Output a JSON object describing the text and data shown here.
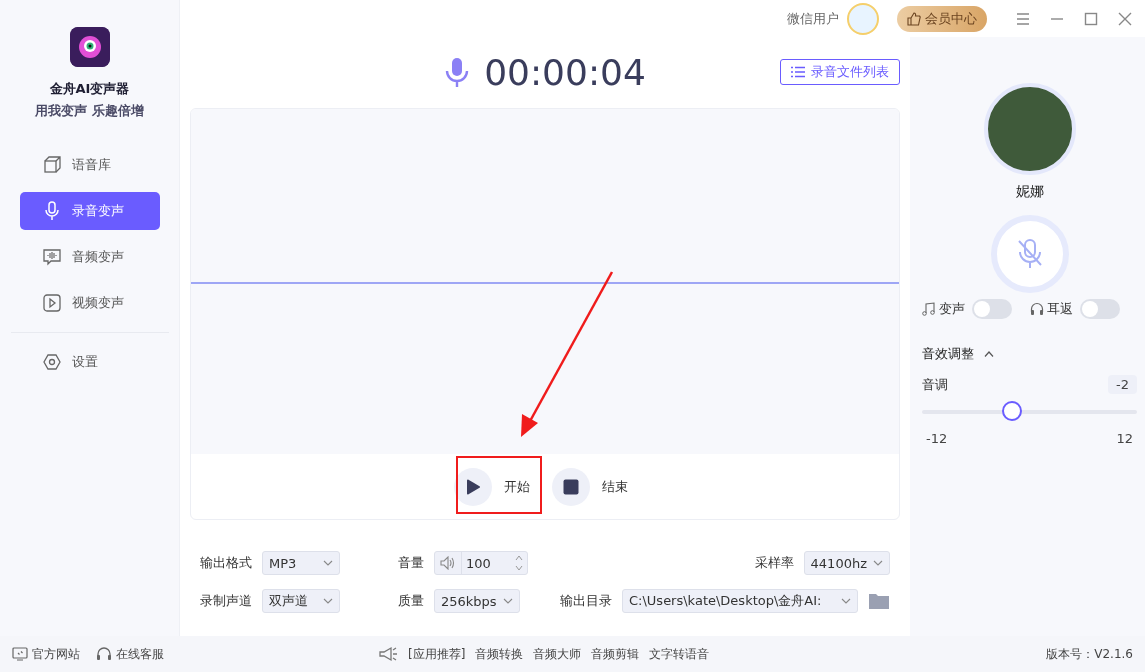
{
  "app": {
    "name": "金舟AI变声器",
    "slogan": "用我变声 乐趣倍增"
  },
  "sidebar": {
    "items": [
      {
        "label": "语音库",
        "kind": "library",
        "selected": false
      },
      {
        "label": "录音变声",
        "kind": "mic",
        "selected": true
      },
      {
        "label": "音频变声",
        "kind": "audio",
        "selected": false
      },
      {
        "label": "视频变声",
        "kind": "video",
        "selected": false
      }
    ],
    "bottom_items": [
      {
        "label": "设置",
        "kind": "settings",
        "selected": false
      }
    ]
  },
  "topbar": {
    "user": "微信用户",
    "vip_button": "会员中心"
  },
  "timer": "00:00:04",
  "record_list_button": "录音文件列表",
  "controls": [
    {
      "label": "开始",
      "kind": "play"
    },
    {
      "label": "结束",
      "kind": "stop"
    }
  ],
  "settings": [
    {
      "label": "输出格式",
      "value": "MP3",
      "kind": "select"
    },
    {
      "label": "音量",
      "value": "100",
      "kind": "volume"
    },
    {
      "label": "采样率",
      "value": "44100hz",
      "kind": "select"
    },
    {
      "label": "录制声道",
      "value": "双声道",
      "kind": "select"
    },
    {
      "label": "质量",
      "value": "256kbps",
      "kind": "select"
    },
    {
      "label": "输出目录",
      "value": "C:\\Users\\kate\\Desktop\\金舟AI:",
      "kind": "folder"
    }
  ],
  "voice": {
    "name": "妮娜"
  },
  "toggles": [
    {
      "label": "变声",
      "kind": "music",
      "on": false
    },
    {
      "label": "耳返",
      "kind": "headphones",
      "on": false
    }
  ],
  "effects": {
    "title": "音效调整",
    "expanded": true,
    "sliders": [
      {
        "label": "音调",
        "reading": "-2",
        "level": 0.417,
        "min": "-12",
        "max": "12"
      }
    ]
  },
  "footer": {
    "links": [
      {
        "label": "官方网站",
        "kind": "web"
      },
      {
        "label": "在线客服",
        "kind": "support"
      }
    ],
    "promo_label": "[应用推荐]",
    "promo_items": [
      "音频转换",
      "音频大师",
      "音频剪辑",
      "文字转语音"
    ],
    "version": "版本号：V2.1.6"
  }
}
